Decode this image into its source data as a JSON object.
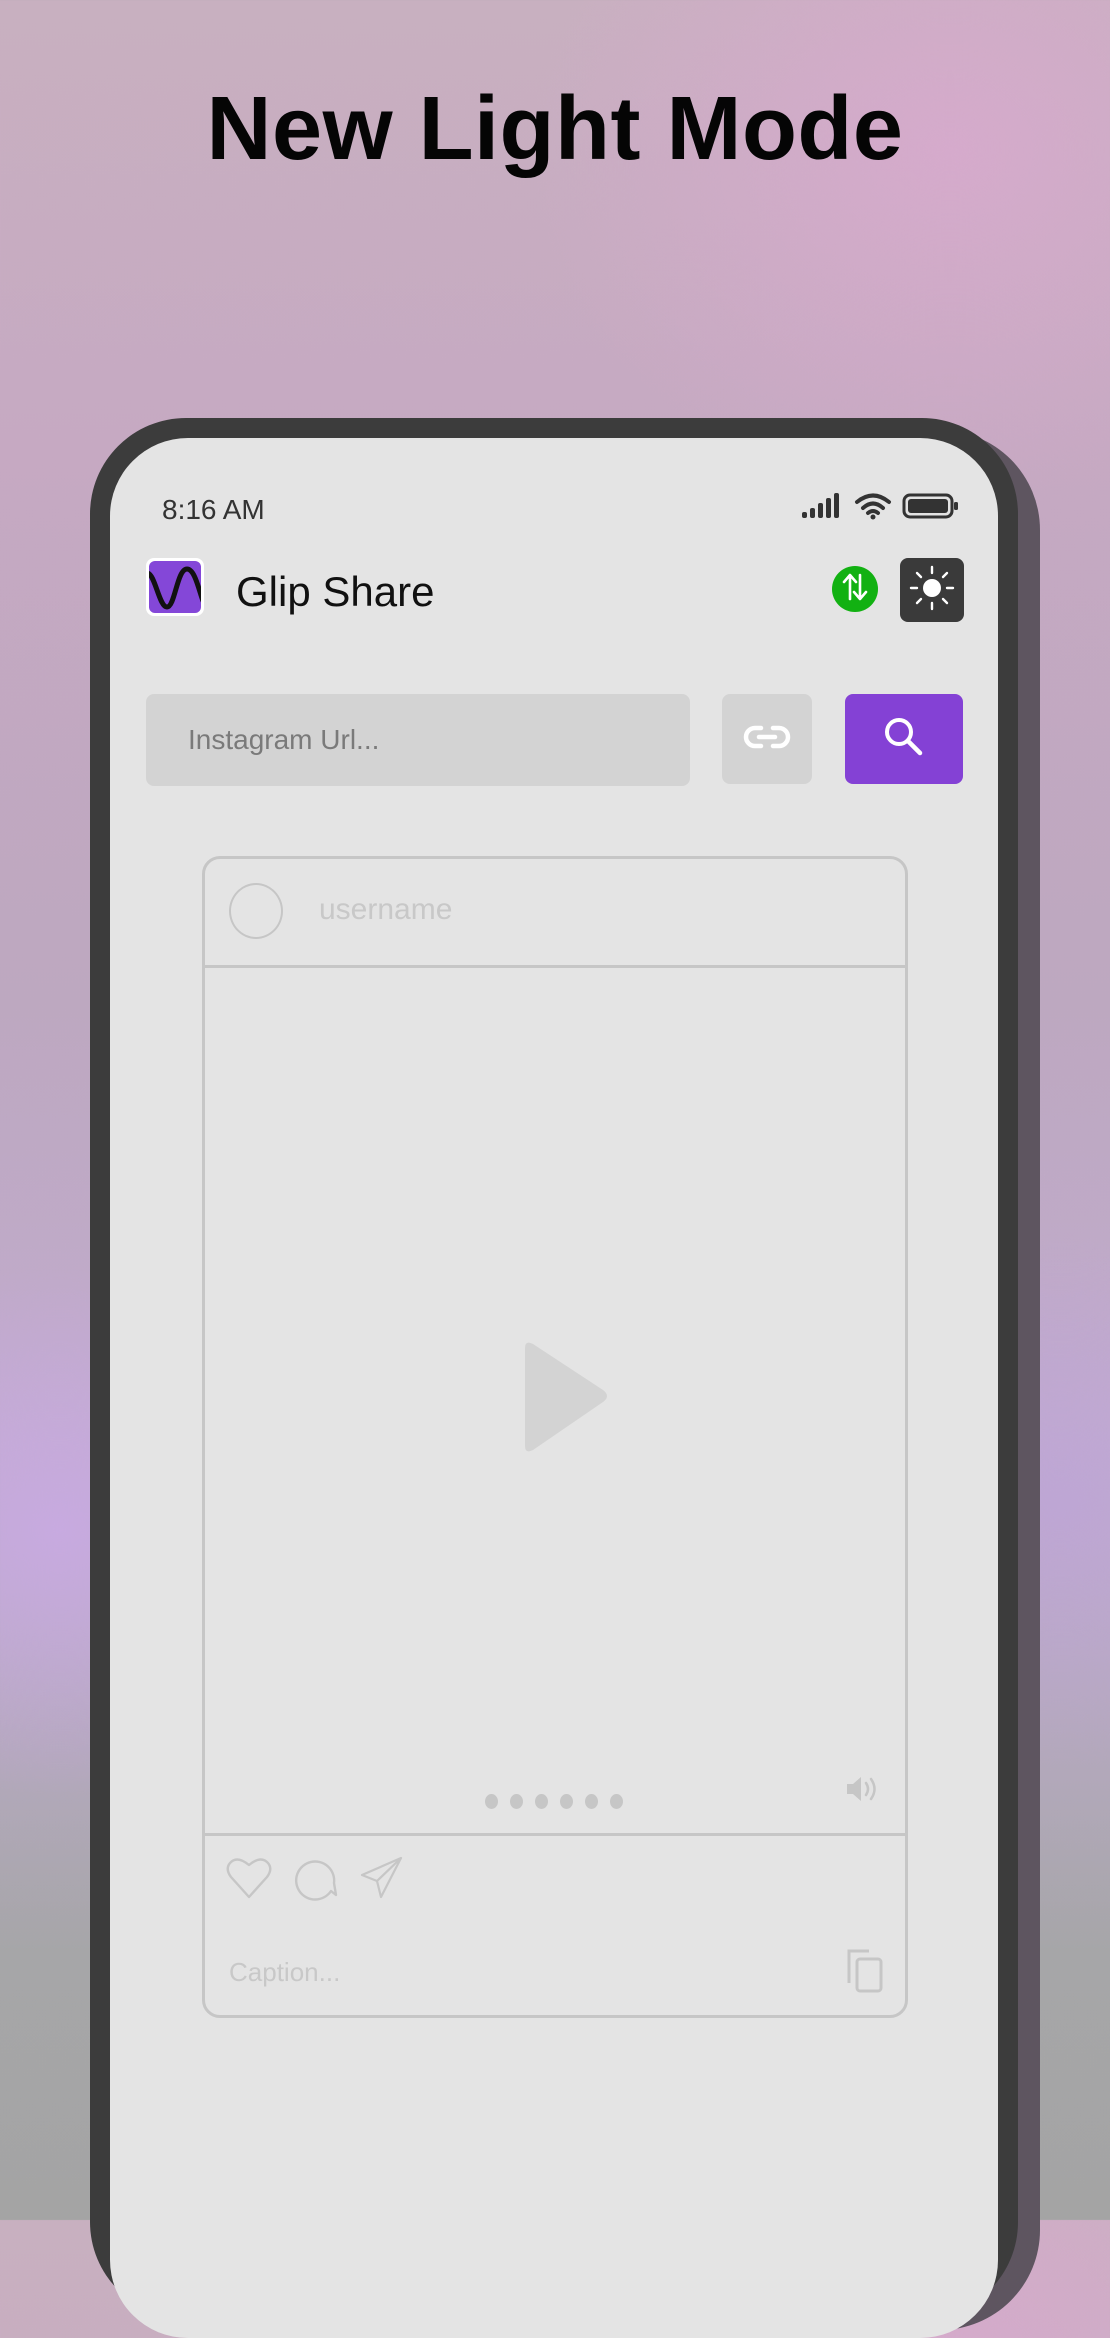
{
  "promo": {
    "headline": "New Light Mode"
  },
  "status_bar": {
    "time": "8:16 AM",
    "icons": [
      "signal-icon",
      "wifi-icon",
      "battery-icon"
    ]
  },
  "app": {
    "title": "Glip Share",
    "logo_icon": "wave-logo-icon",
    "brand_color": "#8447d8",
    "sync_button": {
      "icon": "swap-vertical-icon",
      "color": "#12b112"
    },
    "theme_button": {
      "icon": "sun-icon",
      "color": "#3a3a3a"
    }
  },
  "search": {
    "input_value": "",
    "placeholder": "Instagram Url...",
    "paste_button_icon": "link-icon",
    "search_button_icon": "search-icon",
    "search_button_color": "#8441d5"
  },
  "post_preview": {
    "username": "username",
    "caption_placeholder": "Caption...",
    "media_icon": "play-icon",
    "carousel_dots": 6,
    "volume_icon": "volume-icon",
    "actions": [
      "heart-icon",
      "comment-icon",
      "share-icon"
    ],
    "copy_icon": "copy-icon"
  }
}
